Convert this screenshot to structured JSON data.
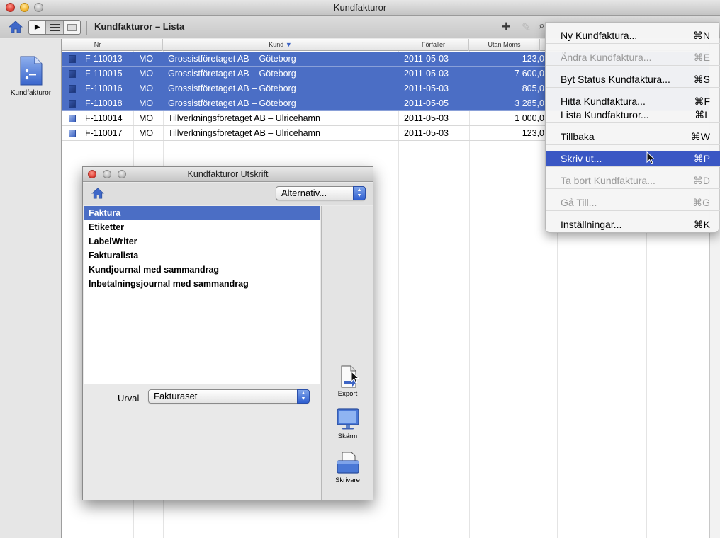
{
  "window": {
    "title": "Kundfakturor"
  },
  "toolbar": {
    "title": "Kundfakturor – Lista",
    "add_label": "+",
    "edit_label": "✎",
    "search_label": "⌕"
  },
  "sidebar": {
    "label": "Kundfakturor"
  },
  "table": {
    "headers": [
      "Nr",
      "Kund",
      "Förfaller",
      "Utan Moms"
    ],
    "rows": [
      {
        "nr": "F-110013",
        "sign": "MO",
        "kund": "Grossistföretaget AB – Göteborg",
        "forfaller": "2011-05-03",
        "utan_moms": "123,0",
        "selected": true
      },
      {
        "nr": "F-110015",
        "sign": "MO",
        "kund": "Grossistföretaget AB – Göteborg",
        "forfaller": "2011-05-03",
        "utan_moms": "7 600,0",
        "selected": true
      },
      {
        "nr": "F-110016",
        "sign": "MO",
        "kund": "Grossistföretaget AB – Göteborg",
        "forfaller": "2011-05-03",
        "utan_moms": "805,0",
        "selected": true
      },
      {
        "nr": "F-110018",
        "sign": "MO",
        "kund": "Grossistföretaget AB – Göteborg",
        "forfaller": "2011-05-05",
        "utan_moms": "3 285,0",
        "selected": true
      },
      {
        "nr": "F-110014",
        "sign": "MO",
        "kund": "Tillverkningsföretaget AB – Ulricehamn",
        "forfaller": "2011-05-03",
        "utan_moms": "1 000,0",
        "selected": false
      },
      {
        "nr": "F-110017",
        "sign": "MO",
        "kund": "Tillverkningsföretaget AB – Ulricehamn",
        "forfaller": "2011-05-03",
        "utan_moms": "123,0",
        "selected": false
      }
    ]
  },
  "menu": {
    "items": [
      {
        "label": "Ny Kundfaktura...",
        "shortcut": "⌘N",
        "disabled": false,
        "highlighted": false
      },
      {
        "label": "Ändra Kundfaktura...",
        "shortcut": "⌘E",
        "disabled": true,
        "highlighted": false
      },
      {
        "label": "Byt Status Kundfaktura...",
        "shortcut": "⌘S",
        "disabled": false,
        "highlighted": false
      },
      {
        "label": "Hitta Kundfaktura...",
        "shortcut": "⌘F",
        "disabled": false,
        "highlighted": false
      },
      {
        "label": "Lista Kundfakturor...",
        "shortcut": "⌘L",
        "disabled": false,
        "highlighted": false
      },
      {
        "label": "Tillbaka",
        "shortcut": "⌘W",
        "disabled": false,
        "highlighted": false
      },
      {
        "label": "Skriv ut...",
        "shortcut": "⌘P",
        "disabled": false,
        "highlighted": true
      },
      {
        "label": "Ta bort Kundfaktura...",
        "shortcut": "⌘D",
        "disabled": true,
        "highlighted": false
      },
      {
        "label": "Gå Till...",
        "shortcut": "⌘G",
        "disabled": true,
        "highlighted": false
      },
      {
        "label": "Inställningar...",
        "shortcut": "⌘K",
        "disabled": false,
        "highlighted": false
      }
    ]
  },
  "dialog": {
    "title": "Kundfakturor Utskrift",
    "options_popup": "Alternativ...",
    "reports": [
      "Faktura",
      "Etiketter",
      "LabelWriter",
      "Fakturalista",
      "Kundjournal med sammandrag",
      "Inbetalningsjournal med sammandrag"
    ],
    "selected_report": "Faktura",
    "urval_label": "Urval",
    "urval_value": "Fakturaset",
    "export_label": "Export",
    "screen_label": "Skärm",
    "printer_label": "Skrivare"
  },
  "colors": {
    "selection": "#4b6ec5",
    "menu_highlight": "#3a57c4",
    "popup_stepper": "#2f5fd0"
  }
}
